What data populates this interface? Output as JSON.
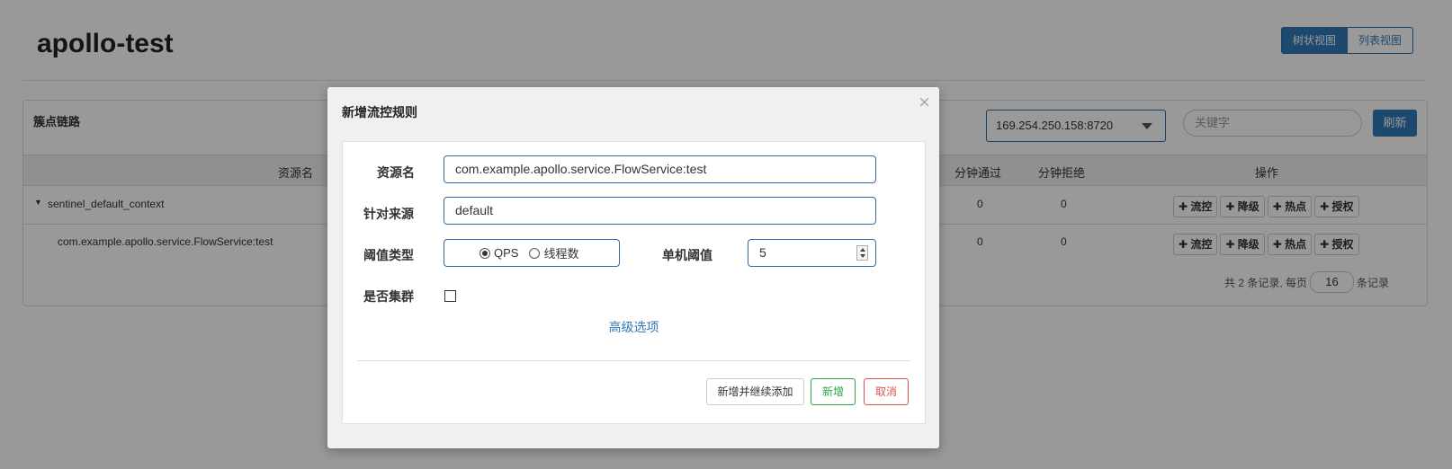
{
  "page": {
    "title": "apollo-test",
    "view_tree": "树状视图",
    "view_list": "列表视图"
  },
  "panel": {
    "title": "簇点链路",
    "machine": "169.254.250.158:8720",
    "keyword_placeholder": "关键字",
    "refresh": "刷新",
    "headers": {
      "resource": "资源名",
      "pass": "分钟通过",
      "block": "分钟拒绝",
      "ops": "操作"
    },
    "rows": [
      {
        "name": "sentinel_default_context",
        "pass": "0",
        "block": "0"
      },
      {
        "name": "com.example.apollo.service.FlowService:test",
        "pass": "0",
        "block": "0"
      }
    ],
    "op_labels": [
      "✚ 流控",
      "✚ 降级",
      "✚ 热点",
      "✚ 授权"
    ],
    "pager_prefix": "共 2 条记录, 每页",
    "page_size": "16",
    "pager_suffix": "条记录"
  },
  "modal": {
    "title": "新增流控规则",
    "close": "×",
    "resource_label": "资源名",
    "resource_value": "com.example.apollo.service.FlowService:test",
    "origin_label": "针对来源",
    "origin_value": "default",
    "threshold_type_label": "阈值类型",
    "qps_label": "QPS",
    "thread_label": "线程数",
    "selected_type": "QPS",
    "single_threshold_label": "单机阈值",
    "single_threshold_value": "5",
    "cluster_label": "是否集群",
    "cluster_checked": false,
    "advanced": "高级选项",
    "btn_continue": "新增并继续添加",
    "btn_add": "新增",
    "btn_cancel": "取消"
  }
}
